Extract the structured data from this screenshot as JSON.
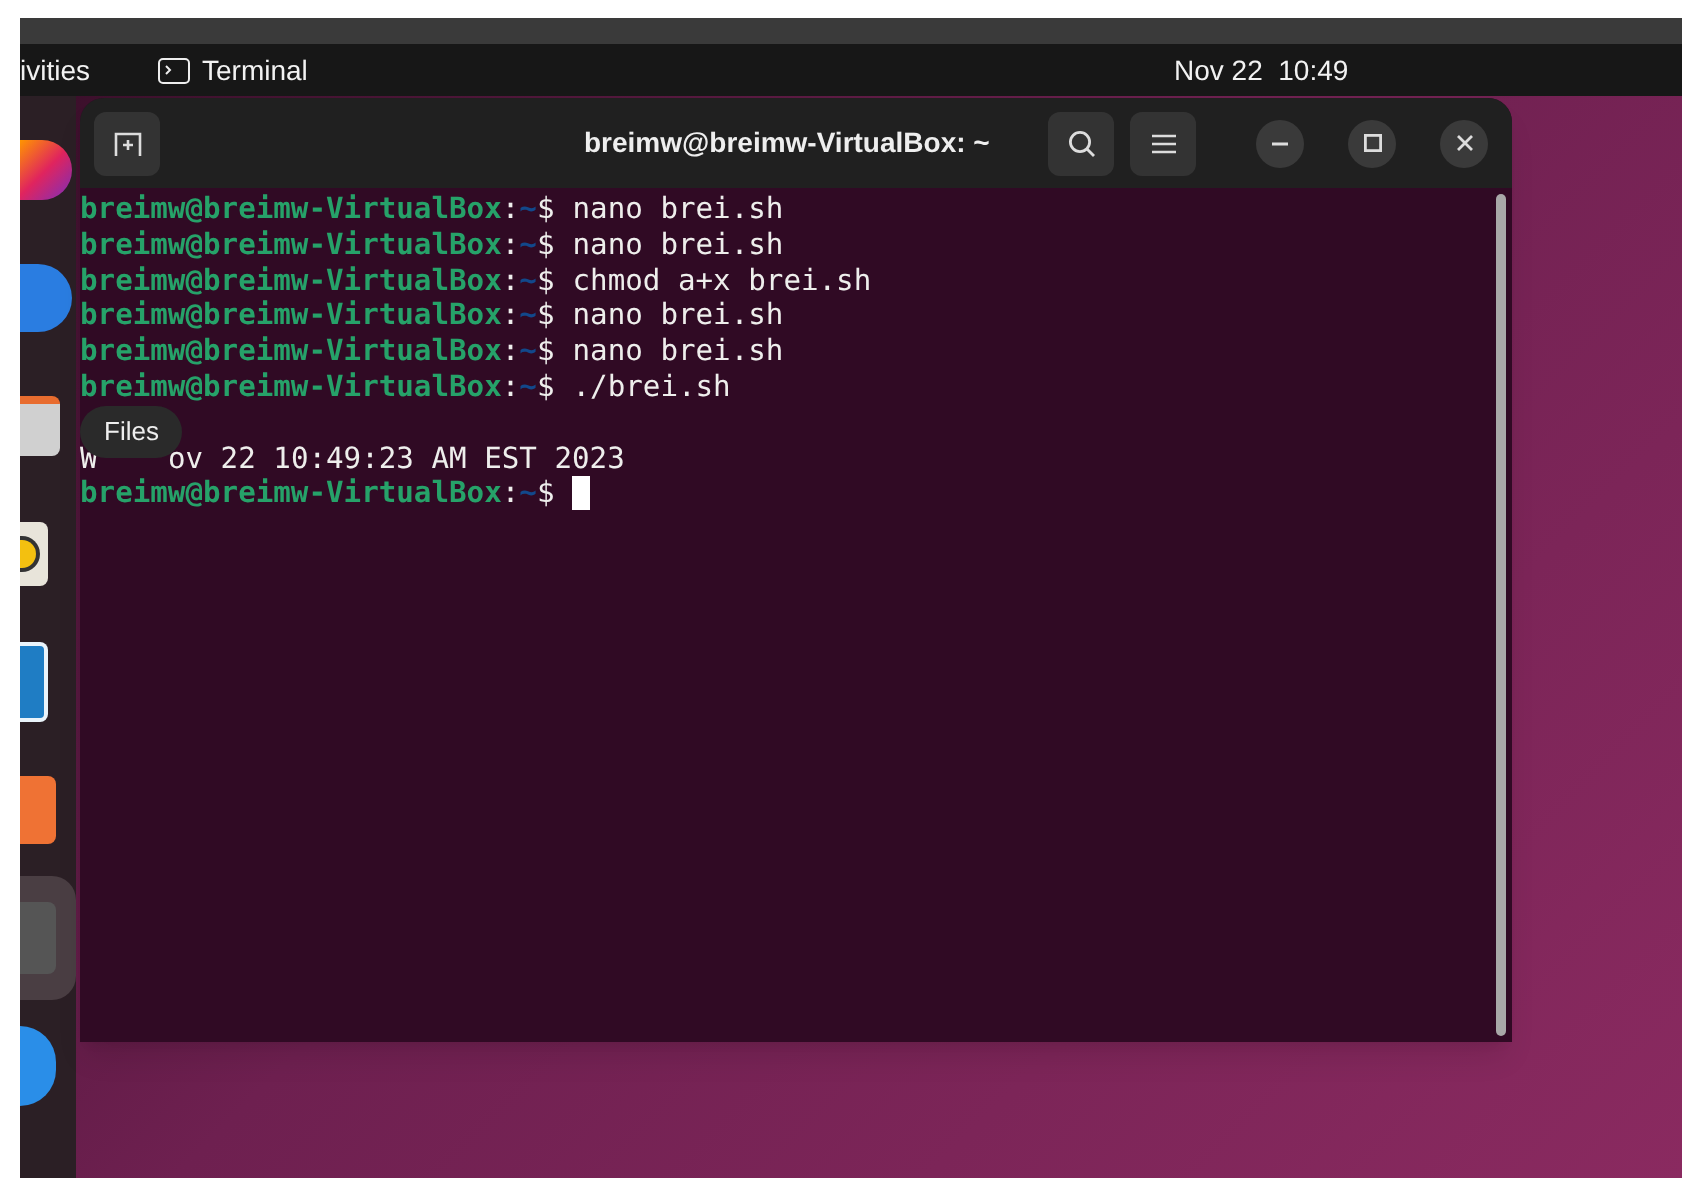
{
  "top_bar": {
    "activities": "ivities",
    "app_name": "Terminal",
    "clock": "Nov 22  10:49"
  },
  "dock": {
    "items": [
      {
        "kind": "browser"
      },
      {
        "kind": "mail"
      },
      {
        "kind": "files",
        "selected": false
      },
      {
        "kind": "music"
      },
      {
        "kind": "writer"
      },
      {
        "kind": "store"
      },
      {
        "kind": "drive",
        "selected": true
      },
      {
        "kind": "help"
      }
    ],
    "tooltip": "Files"
  },
  "window": {
    "title": "breimw@breimw-VirtualBox: ~"
  },
  "terminal": {
    "lines": [
      {
        "kind": "prompt",
        "user": "breimw@breimw-VirtualBox",
        "colon": ":",
        "path": "~",
        "sign": "$",
        "command": "nano brei.sh"
      },
      {
        "kind": "prompt",
        "user": "breimw@breimw-VirtualBox",
        "colon": ":",
        "path": "~",
        "sign": "$",
        "command": "nano brei.sh"
      },
      {
        "kind": "prompt",
        "user": "breimw@breimw-VirtualBox",
        "colon": ":",
        "path": "~",
        "sign": "$",
        "command": "chmod a+x brei.sh"
      },
      {
        "kind": "prompt",
        "user": "breimw@breimw-VirtualBox",
        "colon": ":",
        "path": "~",
        "sign": "$",
        "command": "nano brei.sh"
      },
      {
        "kind": "prompt",
        "user": "breimw@breimw-VirtualBox",
        "colon": ":",
        "path": "~",
        "sign": "$",
        "command": "nano brei.sh"
      },
      {
        "kind": "prompt",
        "user": "breimw@breimw-VirtualBox",
        "colon": ":",
        "path": "~",
        "sign": "$",
        "command": "./brei.sh"
      },
      {
        "kind": "blank"
      },
      {
        "kind": "output",
        "before": "W",
        "after": "ov 22 10:49:23 AM EST 2023"
      },
      {
        "kind": "prompt",
        "user": "breimw@breimw-VirtualBox",
        "colon": ":",
        "path": "~",
        "sign": "$",
        "cursor": true
      }
    ]
  }
}
